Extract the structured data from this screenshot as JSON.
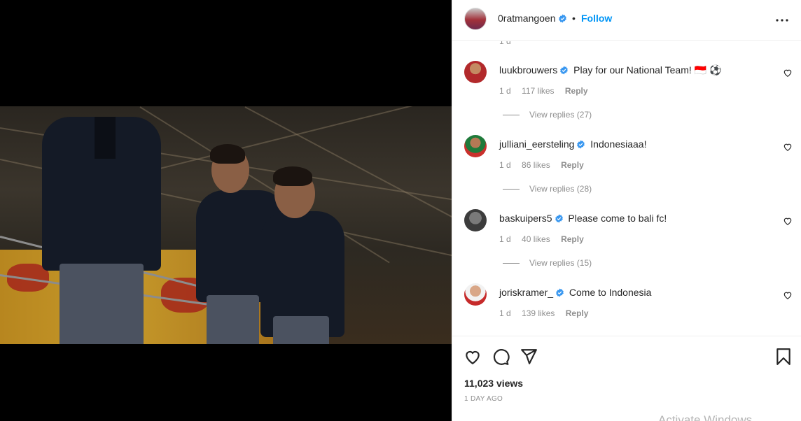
{
  "post": {
    "author": "0ratmangoen",
    "separator": "•",
    "follow_label": "Follow",
    "partial_top_time": "1 d"
  },
  "comments": [
    {
      "username": "luukbrouwers",
      "text": "Play for our National Team! 🇮🇩 ⚽",
      "time": "1 d",
      "likes": "117 likes",
      "reply": "Reply",
      "view_replies": "View replies (27)"
    },
    {
      "username": "julliani_eersteling",
      "text": "Indonesiaaa!",
      "time": "1 d",
      "likes": "86 likes",
      "reply": "Reply",
      "view_replies": "View replies (28)"
    },
    {
      "username": "baskuipers5",
      "text": "Please come to bali fc!",
      "time": "1 d",
      "likes": "40 likes",
      "reply": "Reply",
      "view_replies": "View replies (15)"
    },
    {
      "username": "joriskramer_",
      "text": "Come to Indonesia",
      "time": "1 d",
      "likes": "139 likes",
      "reply": "Reply"
    }
  ],
  "stats": {
    "views": "11,023 views",
    "posted": "1 DAY AGO"
  },
  "os": {
    "watermark": "Activate Windows"
  },
  "colors": {
    "accent": "#0095f6",
    "verified": "#3897f0",
    "muted": "#8e8e8e"
  },
  "icons": [
    "verified-badge-icon",
    "more-options-icon",
    "heart-icon",
    "comment-icon",
    "share-icon",
    "bookmark-icon"
  ]
}
